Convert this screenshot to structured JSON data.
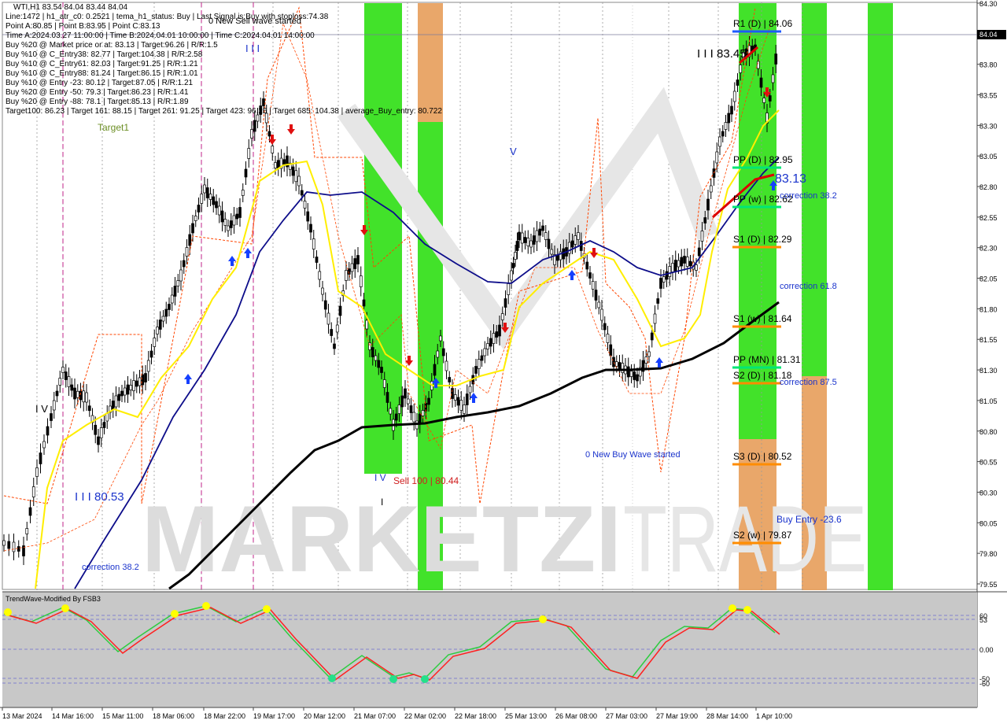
{
  "info_panel": {
    "symbol_line": "WTI,H1  83.54 84.04 83.44 84.04",
    "lines": [
      "Line:1472  |  h1_atr_c0: 0.2521  |  tema_h1_status: Buy  |  Last Signal is:Buy with stoploss:74.38",
      "Point A:80.85  |  Point B:83.95  |  Point C:83.13",
      "Time A:2024.03.27 11:00:00  |  Time B:2024.04.01 10:00:00  |  Time C:2024.04.01 14:00:00",
      "Buy %20 @ Market price or at: 83.13  |  Target:96.26  |  R/R:1.5",
      "Buy %10 @ C_Entry38: 82.77  |  Target:104.38  |  R/R:2.58",
      "Buy %10 @ C_Entry61: 82.03  |  Target:91.25  |  R/R:1.21",
      "Buy %10 @ C_Entry88: 81.24  |  Target:86.15  |  R/R:1.01",
      "Buy %10 @ Entry -23: 80.12  |  Target:87.05  |  R/R:1.21",
      "Buy %20 @ Entry -50: 79.3  |  Target:86.23  |  R/R:1.41",
      "Buy %20 @ Entry -88: 78.1  |  Target:85.13  |  R/R:1.89",
      "Target100: 86.23  |  Target 161: 88.15  |  Target 261: 91.25  |  Target 423: 96.26  |  Target 685: 104.38  |  average_Buy_entry: 80.722"
    ]
  },
  "price_axis": {
    "ticks": [
      "84.30",
      "84.05",
      "83.80",
      "83.55",
      "83.30",
      "83.05",
      "82.80",
      "82.55",
      "82.30",
      "82.05",
      "81.80",
      "81.55",
      "81.30",
      "81.05",
      "80.80",
      "80.55",
      "80.30",
      "80.05",
      "79.80",
      "79.55"
    ],
    "current_price": "84.04"
  },
  "time_axis": {
    "labels": [
      "13 Mar 2024",
      "14 Mar 16:00",
      "15 Mar 11:00",
      "18 Mar 06:00",
      "18 Mar 22:00",
      "19 Mar 17:00",
      "20 Mar 12:00",
      "21 Mar 07:00",
      "22 Mar 02:00",
      "22 Mar 18:00",
      "25 Mar 13:00",
      "26 Mar 08:00",
      "27 Mar 03:00",
      "27 Mar 19:00",
      "28 Mar 14:00",
      "1 Apr 10:00"
    ]
  },
  "levels": [
    {
      "label": "R1 (D) | 84.06",
      "price": 84.06,
      "color": "#1e5aff"
    },
    {
      "label": "PP (D) | 82.95",
      "price": 82.95,
      "color": "#00e676"
    },
    {
      "label": "PP (w) | 82.62",
      "price": 82.62,
      "color": "#00e676"
    },
    {
      "label": "S1 (D) | 82.29",
      "price": 82.29,
      "color": "#ff8c00"
    },
    {
      "label": "S1 (w) | 81.64",
      "price": 81.64,
      "color": "#ff8c00"
    },
    {
      "label": "PP (MN) | 81.31",
      "price": 81.31,
      "color": "#00e676"
    },
    {
      "label": "S2 (D) | 81.18",
      "price": 81.18,
      "color": "#ff8c00"
    },
    {
      "label": "S3 (D) | 80.52",
      "price": 80.52,
      "color": "#ff8c00"
    },
    {
      "label": "S2 (w) | 79.87",
      "price": 79.87,
      "color": "#ff8c00"
    }
  ],
  "annotations": {
    "new_sell_wave": "0 New Sell wave started",
    "new_buy_wave": "0 New Buy Wave started",
    "target1": "Target1",
    "wave_iii_top": "I I I 83.45",
    "wave_iii_left": "I I I 80.53",
    "wave_83_13": "83.13",
    "sell_100": "Sell 100 | 80.44",
    "correction_38_right": "correction 38.2",
    "correction_61_8": "correction 61.8",
    "correction_87_5": "correction 87.5",
    "correction_38_left": "correction 38.2",
    "buy_entry": "Buy Entry -23.6",
    "wave_i_marker": "I V",
    "wave_v_top": "V",
    "wave_iii_marks": "I I I",
    "wave_iv_left": "I V",
    "wave_i_single": "I"
  },
  "watermark": {
    "part1": "MARKETZI",
    "part2": "TRADE"
  },
  "oscillator": {
    "title": "TrendWave-Modified By FSB3",
    "levels": [
      "60",
      "53",
      "0.00",
      "-50",
      "-60"
    ]
  },
  "colors": {
    "green_zone": "#38e01f",
    "orange_zone": "#e8a262",
    "ema_blue": "#0d0d8a",
    "ma_black": "#000000",
    "yellow_line": "#ffee00",
    "envelope_red": "#ff4500",
    "osc_green": "#2ecc40",
    "osc_red": "#ff2020",
    "osc_bg": "#c8c8c8",
    "chart_bg": "#ffffff",
    "label_blue": "#1a33cc"
  }
}
